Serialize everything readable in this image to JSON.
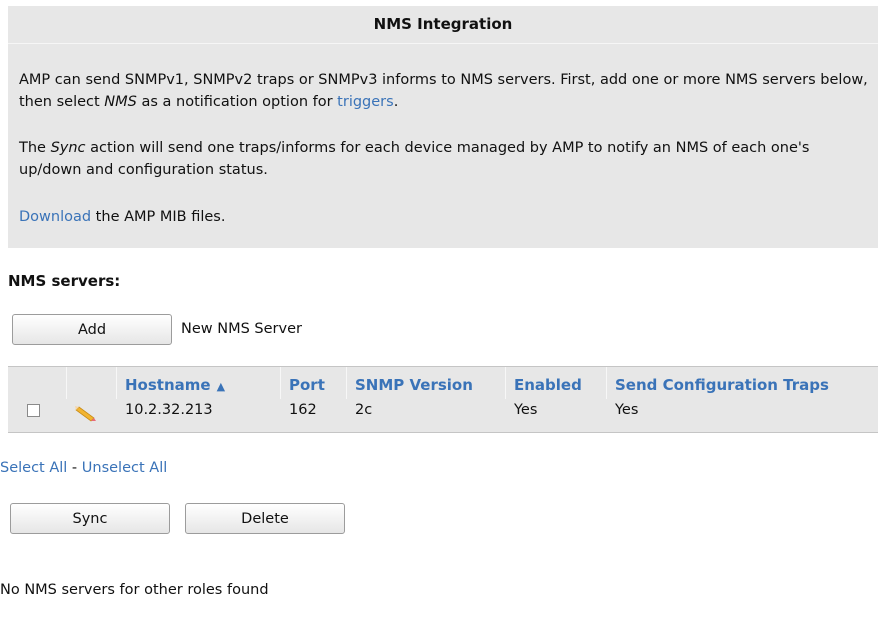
{
  "panel": {
    "title": "NMS Integration",
    "para1": {
      "part1": "AMP can send SNMPv1, SNMPv2 traps or SNMPv3 informs to NMS servers. First, add one or more NMS servers below, then select ",
      "em": "NMS",
      "part2": " as a notification option for ",
      "link": "triggers",
      "part3": "."
    },
    "para2": {
      "part1": "The ",
      "em": "Sync",
      "part2": " action will send one traps/informs for each device managed by AMP to notify an NMS of each one's up/down and configuration status."
    },
    "para3": {
      "link": "Download",
      "part1": " the AMP MIB files."
    }
  },
  "servers": {
    "heading": "NMS servers:",
    "add_button": "Add",
    "add_caption": "New NMS Server",
    "columns": {
      "hostname": "Hostname",
      "hostname_sort": "▲",
      "port": "Port",
      "snmp_version": "SNMP Version",
      "enabled": "Enabled",
      "send_config_traps": "Send Configuration Traps"
    },
    "rows": [
      {
        "hostname": "10.2.32.213",
        "port": "162",
        "snmp_version": "2c",
        "enabled": "Yes",
        "send_config_traps": "Yes",
        "checked": false
      }
    ],
    "select_all": "Select All",
    "separator": " - ",
    "unselect_all": "Unselect All",
    "sync_button": "Sync",
    "delete_button": "Delete",
    "other_roles_message": "No NMS servers for other roles found"
  }
}
